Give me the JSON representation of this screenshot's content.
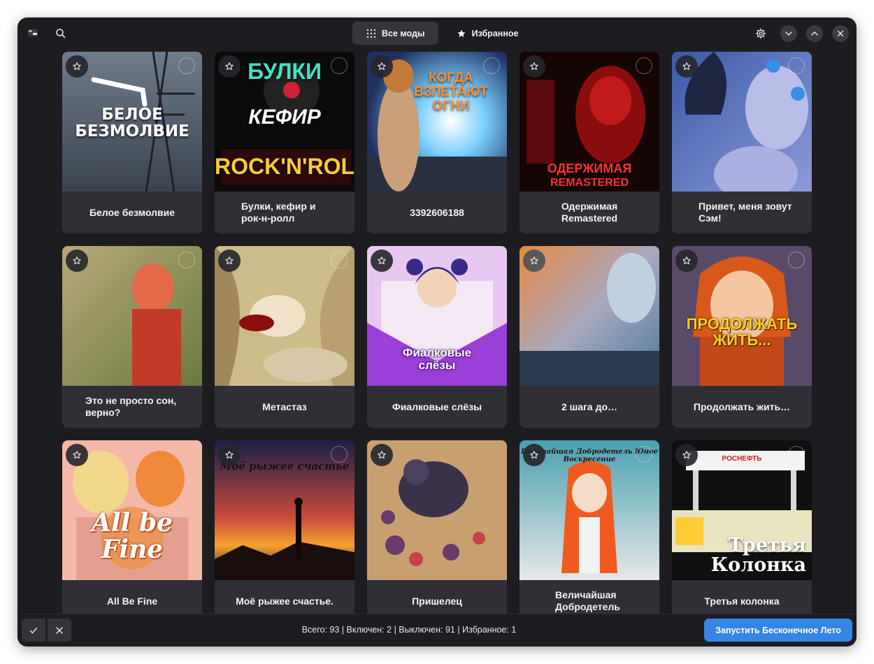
{
  "header": {
    "tabs": [
      {
        "label": "Все моды",
        "icon": "grid-icon",
        "active": true
      },
      {
        "label": "Избранное",
        "icon": "star-filled-icon",
        "active": false
      }
    ]
  },
  "mods": [
    {
      "title": "Белое безмолвие",
      "art_text": "БЕЛОЕ\nБЕЗМОЛВИЕ"
    },
    {
      "title": "Булки, кефир и рок-н-ролл",
      "art_text": "БУЛКИ КЕФИР ROCK'N'ROLL"
    },
    {
      "title": "3392606188",
      "art_text": "КОГДА ВЗЛЕТАЮТ ОГНИ"
    },
    {
      "title": "Одержимая Remastered",
      "art_text": "ОДЕРЖИМАЯ REMASTERED"
    },
    {
      "title": "Привет, меня зовут Сэм!",
      "art_text": ""
    },
    {
      "title": "Это не просто сон, верно?",
      "art_text": ""
    },
    {
      "title": "Метастаз",
      "art_text": ""
    },
    {
      "title": "Фиалковые слёзы",
      "art_text": "Фиалковые слёзы"
    },
    {
      "title": "2 шага до…",
      "art_text": ""
    },
    {
      "title": "Продолжать жить…",
      "art_text": "ПРОДОЛЖАТЬ ЖИТЬ..."
    },
    {
      "title": "All Be Fine",
      "art_text": "All be Fine"
    },
    {
      "title": "Моё рыжее счастье.",
      "art_text": "Моё рыжее счастье"
    },
    {
      "title": "Пришелец",
      "art_text": ""
    },
    {
      "title": "Величайшая Добродетель",
      "art_text": "Величайшая Добродетель Юное Воскресение"
    },
    {
      "title": "Третья колонка",
      "art_text": "Третья Колонка"
    }
  ],
  "footer": {
    "stats": "Всего: 93 | Включен: 2 | Выключен: 91 | Избранное: 1",
    "launch_label": "Запустить Бесконечное Лето"
  },
  "colors": {
    "background": "#1d1d21",
    "card": "#2f2f35",
    "accent": "#3585e5"
  }
}
